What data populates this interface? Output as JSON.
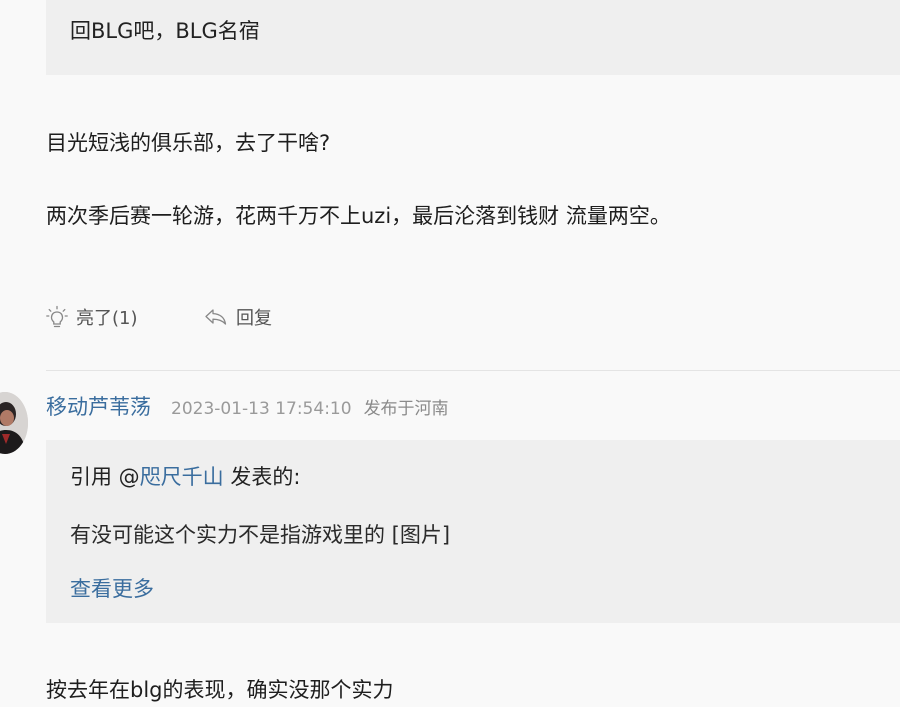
{
  "previous_comment": {
    "quote_text": "回BLG吧，BLG名宿",
    "body_lines": [
      "目光短浅的俱乐部，去了干啥?",
      "两次季后赛一轮游，花两千万不上uzi，最后沦落到钱财 流量两空。"
    ],
    "like_label": "亮了(1)",
    "reply_label": "回复"
  },
  "comment": {
    "username": "移动芦苇荡",
    "timestamp": "2023-01-13 17:54:10",
    "location": "发布于河南",
    "quote": {
      "prefix": "引用 @",
      "mention": "咫尺千山",
      "suffix": " 发表的:",
      "text": "有没可能这个实力不是指游戏里的 [图片]",
      "see_more": "查看更多"
    },
    "body_lines": [
      "按去年在blg的表现，确实没那个实力"
    ]
  },
  "colors": {
    "page_bg": "#f9f9f9",
    "quote_bg": "#efefef",
    "link": "#3a6d9e",
    "meta_gray": "#9a9a9a"
  },
  "icons": {
    "like": "lightbulb-icon",
    "reply": "reply-arrow-icon"
  }
}
